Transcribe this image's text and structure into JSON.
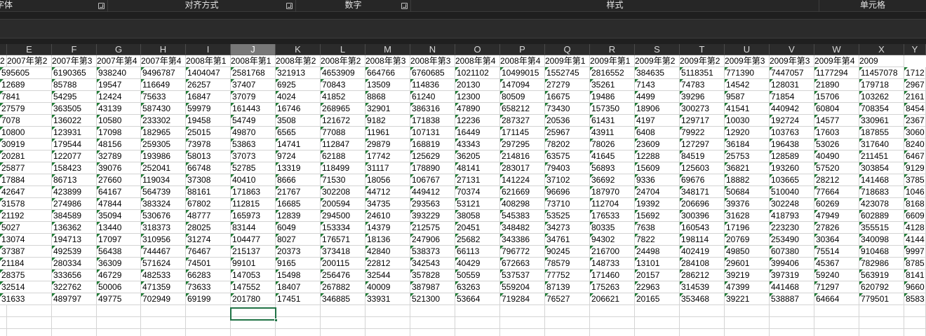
{
  "ribbon": {
    "groups": [
      {
        "label": "字体",
        "id": "font"
      },
      {
        "label": "对齐方式",
        "id": "alignment"
      },
      {
        "label": "数字",
        "id": "number"
      },
      {
        "label": "样式",
        "id": "styles"
      },
      {
        "label": "单元格",
        "id": "cells"
      }
    ]
  },
  "sheet": {
    "selected_column": "J",
    "selected_cell": "J23",
    "columns": [
      "E",
      "F",
      "G",
      "H",
      "I",
      "J",
      "K",
      "L",
      "M",
      "N",
      "O",
      "P",
      "Q",
      "R",
      "S",
      "T",
      "U",
      "V",
      "W",
      "X",
      "Y"
    ],
    "header_row": [
      "2007年第2",
      "2007年第3",
      "2007年第4",
      "2007年第4",
      "2008年第1",
      "2008年第1",
      "2008年第2",
      "2008年第2",
      "2008年第3",
      "2008年第3",
      "2008年第4",
      "2008年第4",
      "2009年第1",
      "2009年第1",
      "2009年第2",
      "2009年第2",
      "2009年第3",
      "2009年第3",
      "2009年第4",
      "2009"
    ],
    "first_header_fragment": "2",
    "rows": [
      [
        "595605",
        "6190365",
        "938240",
        "9496787",
        "1404047",
        "2581768",
        "321913",
        "4653909",
        "664766",
        "6760685",
        "1021102",
        "10499015",
        "1552745",
        "2816552",
        "384635",
        "5118351",
        "771390",
        "7447057",
        "1177294",
        "11457078",
        "1712"
      ],
      [
        "12689",
        "85788",
        "19547",
        "116649",
        "26257",
        "37407",
        "6925",
        "70843",
        "13509",
        "114836",
        "20130",
        "147094",
        "27279",
        "35261",
        "7143",
        "74783",
        "14542",
        "128031",
        "21890",
        "179718",
        "2967"
      ],
      [
        "7841",
        "54295",
        "12424",
        "75633",
        "16847",
        "37079",
        "4024",
        "41852",
        "8868",
        "61240",
        "12300",
        "80509",
        "16675",
        "19486",
        "4499",
        "39296",
        "9587",
        "71854",
        "15706",
        "103262",
        "2161"
      ],
      [
        "27579",
        "363505",
        "43139",
        "587430",
        "59979",
        "161443",
        "16746",
        "268965",
        "32901",
        "386316",
        "47890",
        "658212",
        "73430",
        "157350",
        "18906",
        "300273",
        "41541",
        "440942",
        "60804",
        "708354",
        "8454"
      ],
      [
        "7078",
        "136022",
        "10580",
        "233302",
        "19458",
        "54749",
        "3508",
        "121672",
        "9182",
        "171838",
        "12236",
        "287327",
        "20536",
        "61431",
        "4197",
        "129717",
        "10030",
        "192724",
        "14577",
        "330961",
        "2367"
      ],
      [
        "10800",
        "123931",
        "17098",
        "182965",
        "25015",
        "49870",
        "6565",
        "77088",
        "11961",
        "107131",
        "16449",
        "171145",
        "25967",
        "43911",
        "6408",
        "79922",
        "12920",
        "103763",
        "17603",
        "187855",
        "3060"
      ],
      [
        "30919",
        "179544",
        "48156",
        "259305",
        "73978",
        "53863",
        "14741",
        "112847",
        "29879",
        "168819",
        "43343",
        "297295",
        "78202",
        "78026",
        "23609",
        "127297",
        "36184",
        "196438",
        "53026",
        "317640",
        "8240"
      ],
      [
        "20281",
        "122077",
        "32789",
        "193986",
        "58013",
        "37073",
        "9724",
        "62188",
        "17742",
        "125629",
        "36205",
        "214816",
        "63575",
        "41645",
        "12288",
        "84519",
        "25753",
        "128589",
        "40490",
        "211451",
        "6467"
      ],
      [
        "25877",
        "158423",
        "39076",
        "252041",
        "66748",
        "52785",
        "13319",
        "118499",
        "31117",
        "178890",
        "48141",
        "283017",
        "79403",
        "56893",
        "15609",
        "125603",
        "36821",
        "193260",
        "57520",
        "303854",
        "9129"
      ],
      [
        "17884",
        "86713",
        "27660",
        "119034",
        "37308",
        "40410",
        "8666",
        "71530",
        "18056",
        "106767",
        "27131",
        "141224",
        "37102",
        "36692",
        "9336",
        "69676",
        "18882",
        "103665",
        "28212",
        "141468",
        "3785"
      ],
      [
        "42647",
        "423899",
        "64167",
        "564739",
        "88161",
        "171863",
        "21767",
        "302208",
        "44712",
        "449412",
        "70374",
        "621669",
        "96696",
        "187970",
        "24704",
        "348171",
        "50684",
        "510040",
        "77664",
        "718683",
        "1046"
      ],
      [
        "31578",
        "274986",
        "47844",
        "383324",
        "67802",
        "112815",
        "16685",
        "200594",
        "34735",
        "293563",
        "53121",
        "408298",
        "73710",
        "112704",
        "19392",
        "206696",
        "39376",
        "302248",
        "60269",
        "423078",
        "8168"
      ],
      [
        "21192",
        "384589",
        "35094",
        "530676",
        "48777",
        "165973",
        "12839",
        "294500",
        "24610",
        "393229",
        "38058",
        "545383",
        "53525",
        "176533",
        "15692",
        "300396",
        "31628",
        "418793",
        "47949",
        "602889",
        "6609"
      ],
      [
        "5027",
        "136362",
        "13440",
        "318373",
        "28025",
        "83144",
        "6049",
        "153334",
        "14379",
        "212575",
        "20451",
        "348482",
        "34273",
        "80335",
        "7638",
        "160543",
        "17196",
        "223230",
        "27826",
        "355515",
        "4128"
      ],
      [
        "13074",
        "194713",
        "17097",
        "310956",
        "31274",
        "104477",
        "8027",
        "176571",
        "18136",
        "247906",
        "25682",
        "343386",
        "34761",
        "94302",
        "7822",
        "198114",
        "20769",
        "253490",
        "30364",
        "340098",
        "4144"
      ],
      [
        "37387",
        "492539",
        "56438",
        "744467",
        "76467",
        "215137",
        "20373",
        "373418",
        "42840",
        "538373",
        "66113",
        "796772",
        "90245",
        "216700",
        "24498",
        "402419",
        "49850",
        "607380",
        "75514",
        "910468",
        "9997"
      ],
      [
        "21184",
        "280334",
        "36309",
        "571624",
        "74501",
        "99101",
        "9165",
        "200115",
        "22812",
        "342543",
        "40429",
        "672663",
        "78579",
        "148733",
        "13101",
        "284108",
        "29601",
        "399406",
        "45367",
        "782986",
        "8785"
      ],
      [
        "28375",
        "333656",
        "46729",
        "482533",
        "66283",
        "147053",
        "15498",
        "256476",
        "32544",
        "357828",
        "50559",
        "537537",
        "77752",
        "171460",
        "20157",
        "286212",
        "39219",
        "397319",
        "59240",
        "563919",
        "8141"
      ],
      [
        "32514",
        "322762",
        "50006",
        "471359",
        "73633",
        "147552",
        "18407",
        "267882",
        "40009",
        "387987",
        "63263",
        "559204",
        "87139",
        "175263",
        "22963",
        "314539",
        "47399",
        "441468",
        "71297",
        "620792",
        "9660"
      ],
      [
        "31633",
        "489797",
        "49775",
        "702949",
        "69199",
        "201780",
        "17451",
        "346885",
        "33931",
        "521300",
        "53664",
        "719284",
        "76527",
        "206621",
        "20165",
        "353468",
        "39221",
        "538887",
        "64664",
        "779501",
        "8583"
      ]
    ]
  }
}
